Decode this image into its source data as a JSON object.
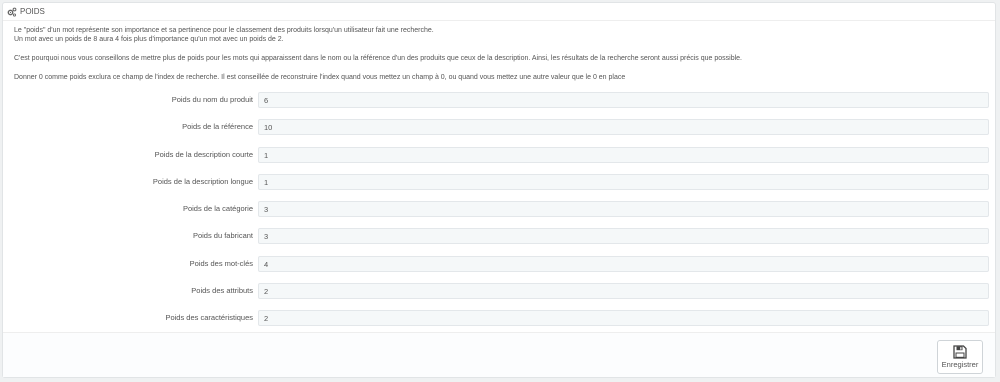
{
  "panel": {
    "title": "POIDS",
    "heading_icon": "cogs-icon"
  },
  "intro": {
    "line1": "Le \"poids\" d'un mot représente son importance et sa pertinence pour le classement des produits lorsqu'un utilisateur fait une recherche.",
    "line2": "Un mot avec un poids de 8 aura 4 fois plus d'importance qu'un mot avec un poids de 2.",
    "line3": "C'est pourquoi nous vous conseillons de mettre plus de poids pour les mots qui apparaissent dans le nom ou la référence d'un des produits que ceux de la description. Ainsi, les résultats de la recherche seront aussi précis que possible.",
    "line4": "Donner 0 comme poids exclura ce champ de l'index de recherche. Il est conseillée de reconstruire l'index quand vous mettez un champ à 0, ou quand vous mettez une autre valeur que le 0 en place"
  },
  "fields": [
    {
      "label": "Poids du nom du produit",
      "value": "6"
    },
    {
      "label": "Poids de la référence",
      "value": "10"
    },
    {
      "label": "Poids de la description courte",
      "value": "1"
    },
    {
      "label": "Poids de la description longue",
      "value": "1"
    },
    {
      "label": "Poids de la catégorie",
      "value": "3"
    },
    {
      "label": "Poids du fabricant",
      "value": "3"
    },
    {
      "label": "Poids des mot-clés",
      "value": "4"
    },
    {
      "label": "Poids des attributs",
      "value": "2"
    },
    {
      "label": "Poids des caractéristiques",
      "value": "2"
    }
  ],
  "footer": {
    "save_label": "Enregistrer",
    "save_icon": "save-icon"
  }
}
